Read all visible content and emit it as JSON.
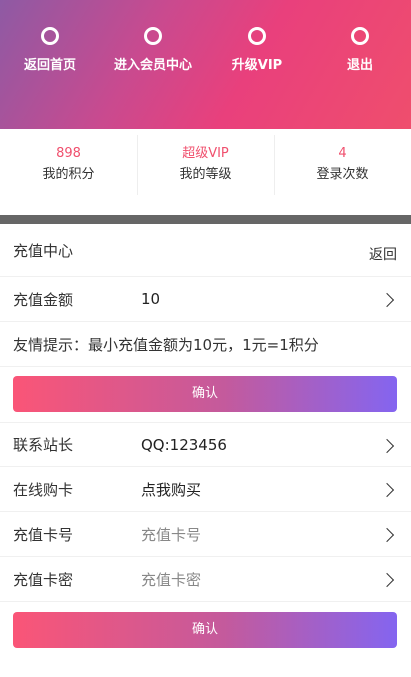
{
  "nav": {
    "items": [
      {
        "label": "返回首页",
        "icon": "circle-icon"
      },
      {
        "label": "进入会员中心",
        "icon": "circle-icon"
      },
      {
        "label": "升级VIP",
        "icon": "circle-icon"
      },
      {
        "label": "退出",
        "icon": "circle-icon"
      }
    ]
  },
  "stats": [
    {
      "value": "898",
      "caption": "我的积分"
    },
    {
      "value": "超级VIP",
      "caption": "我的等级"
    },
    {
      "value": "4",
      "caption": "登录次数"
    }
  ],
  "recharge": {
    "title": "充值中心",
    "back_label": "返回",
    "amount_label": "充值金额",
    "amount_value": "10",
    "tip": "友情提示：最小充值金额为10元，1元=1积分",
    "confirm_label": "确认"
  },
  "card": {
    "contact_label": "联系站长",
    "contact_value": "QQ:123456",
    "buy_label": "在线购卡",
    "buy_value": "点我购买",
    "card_no_label": "充值卡号",
    "card_no_placeholder": "充值卡号",
    "card_pw_label": "充值卡密",
    "card_pw_placeholder": "充值卡密",
    "confirm_label": "确认"
  },
  "colors": {
    "accent": "#f0506e",
    "button_gradient_start": "#fa5577",
    "button_gradient_end": "#8465f0"
  }
}
